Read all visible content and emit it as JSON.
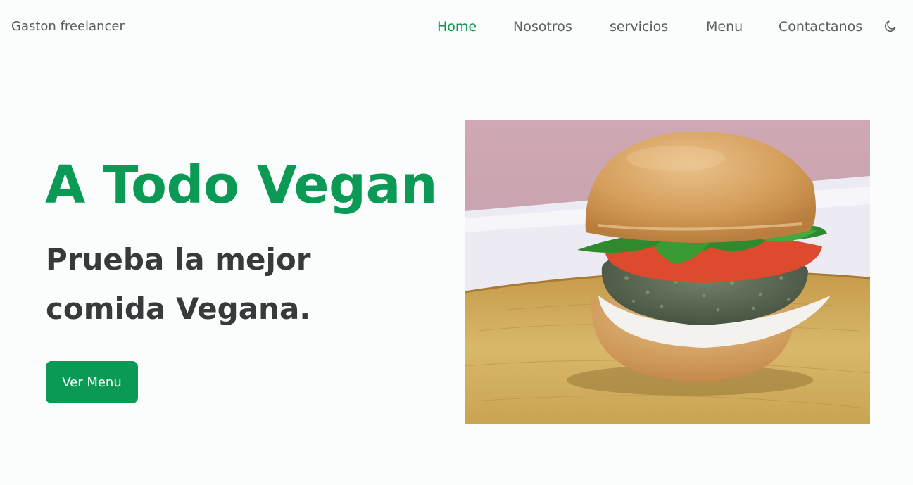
{
  "header": {
    "brand": "Gaston freelancer",
    "nav": [
      {
        "label": "Home",
        "active": true
      },
      {
        "label": "Nosotros",
        "active": false
      },
      {
        "label": "servicios",
        "active": false
      },
      {
        "label": "Menu",
        "active": false
      },
      {
        "label": "Contactanos",
        "active": false
      }
    ],
    "theme_icon": "moon-icon"
  },
  "hero": {
    "title": "A Todo Vegan",
    "subtitle": "Prueba la mejor comida Vegana.",
    "cta_label": "Ver Menu",
    "image_subject": "vegan burger with greens patty, tomato, spinach and cream on a wooden board"
  },
  "colors": {
    "accent": "#0b9a55",
    "active_nav": "#0b9350",
    "text_dark": "#363a3a",
    "text_muted": "#5a5f5f",
    "background": "#fbfdfd"
  }
}
